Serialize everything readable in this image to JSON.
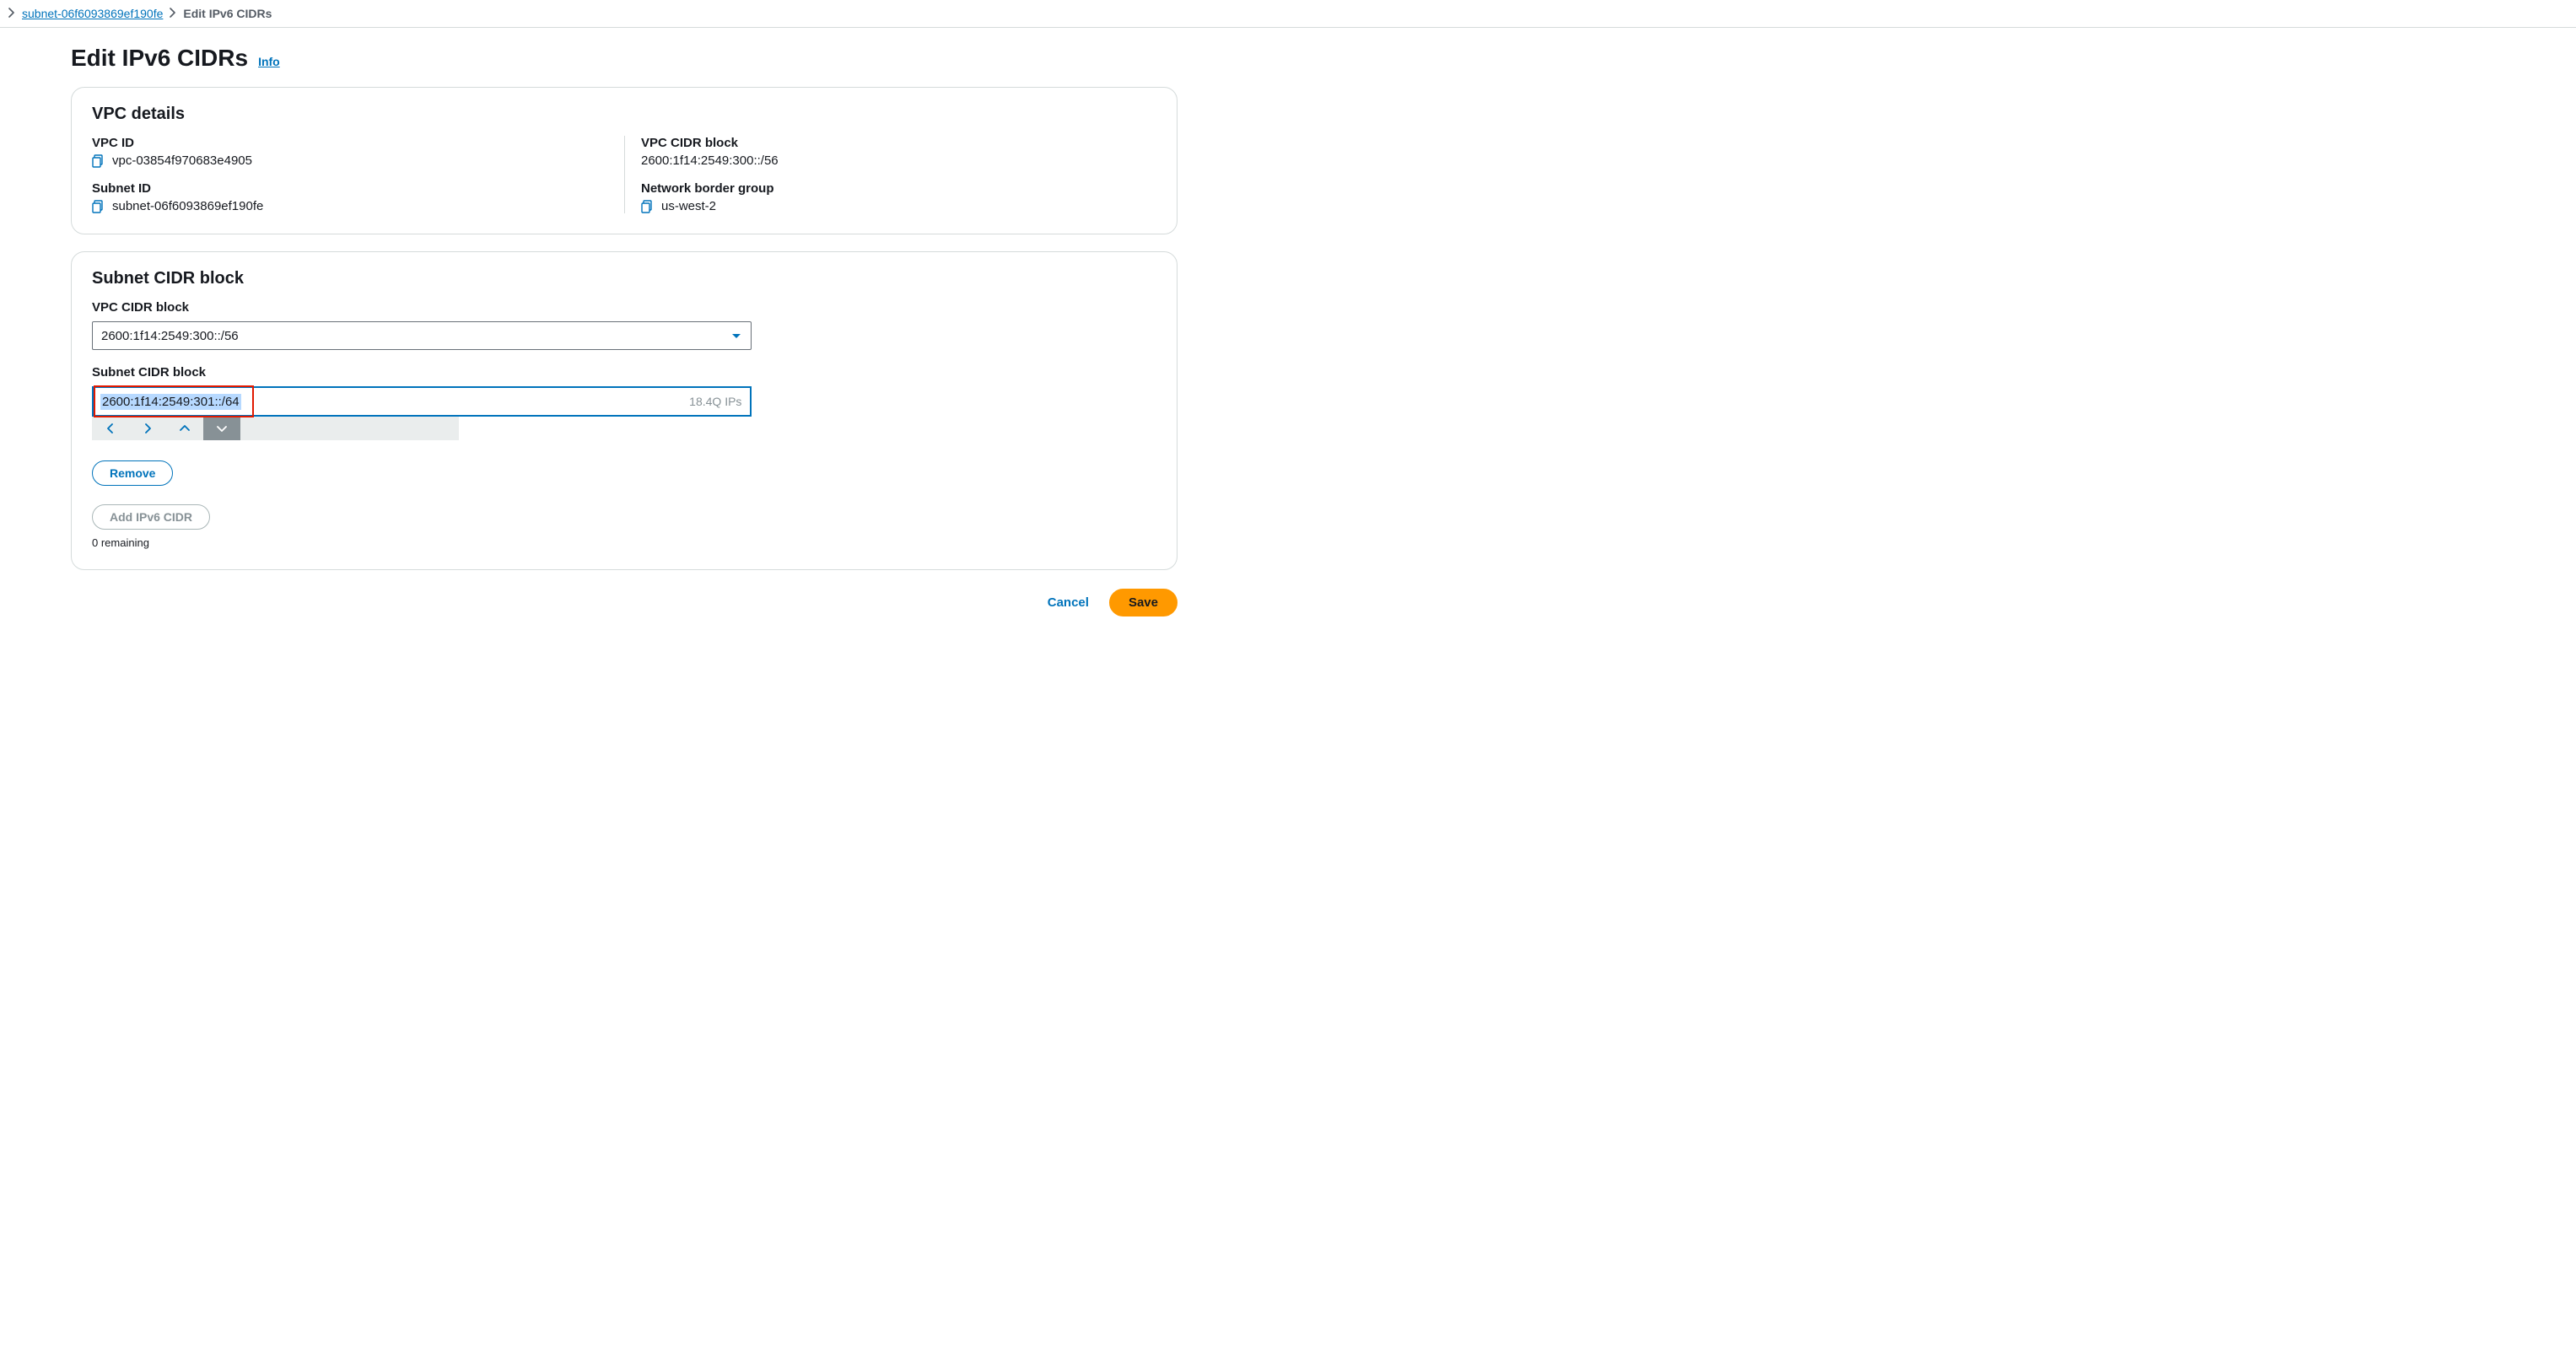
{
  "breadcrumb": {
    "parent_link": "subnet-06f6093869ef190fe",
    "current": "Edit IPv6 CIDRs"
  },
  "header": {
    "title": "Edit IPv6 CIDRs",
    "info_label": "Info"
  },
  "vpc_details": {
    "panel_title": "VPC details",
    "vpc_id_label": "VPC ID",
    "vpc_id_value": "vpc-03854f970683e4905",
    "subnet_id_label": "Subnet ID",
    "subnet_id_value": "subnet-06f6093869ef190fe",
    "vpc_cidr_label": "VPC CIDR block",
    "vpc_cidr_value": "2600:1f14:2549:300::/56",
    "nbg_label": "Network border group",
    "nbg_value": "us-west-2"
  },
  "subnet_cidr": {
    "panel_title": "Subnet CIDR block",
    "vpc_cidr_select_label": "VPC CIDR block",
    "vpc_cidr_select_value": "2600:1f14:2549:300::/56",
    "subnet_cidr_input_label": "Subnet CIDR block",
    "subnet_cidr_input_value": "2600:1f14:2549:301::/64",
    "ip_count": "18.4Q IPs",
    "remove_label": "Remove",
    "add_label": "Add IPv6 CIDR",
    "remaining": "0 remaining"
  },
  "footer": {
    "cancel": "Cancel",
    "save": "Save"
  }
}
